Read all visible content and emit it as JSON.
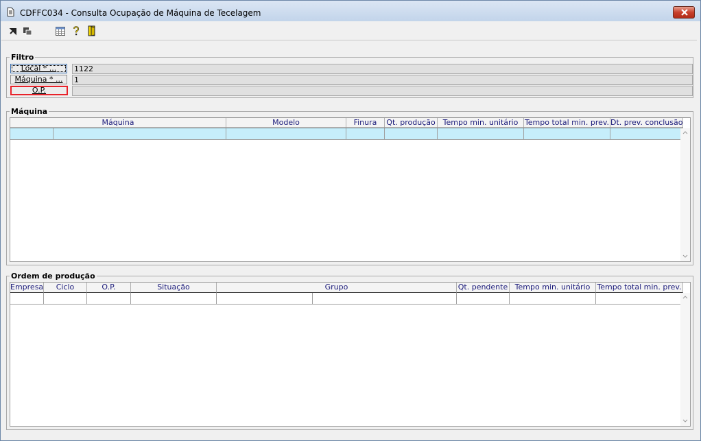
{
  "window": {
    "title": "CDFFC034 - Consulta Ocupação de Máquina de Tecelagem"
  },
  "toolbar": {
    "icons": [
      "arrow-nw-icon",
      "restore-icon",
      "calendar-grid-icon",
      "help-question-icon",
      "exit-door-icon"
    ]
  },
  "filtro": {
    "title": "Filtro",
    "local_label": "Local * ...",
    "local_value": "1122",
    "maquina_label": "Máquina * ...",
    "maquina_value": "1",
    "op_label": "O.P.",
    "op_value": ""
  },
  "maquina": {
    "title": "Máquina",
    "columns": [
      "Máquina",
      "Modelo",
      "Finura",
      "Qt. produção",
      "Tempo min. unitário",
      "Tempo total min. prev.",
      "Dt. prev. conclusão"
    ]
  },
  "ordem": {
    "title": "Ordem de produção",
    "columns": [
      "Empresa",
      "Ciclo",
      "O.P.",
      "Situação",
      "Grupo",
      "Qt. pendente",
      "Tempo min. unitário",
      "Tempo total min. prev."
    ]
  },
  "colors": {
    "accent": "#3a6fb0",
    "selected_row": "#c6eefb",
    "header_text": "#1a1a7a",
    "required_border": "#e8222a"
  }
}
